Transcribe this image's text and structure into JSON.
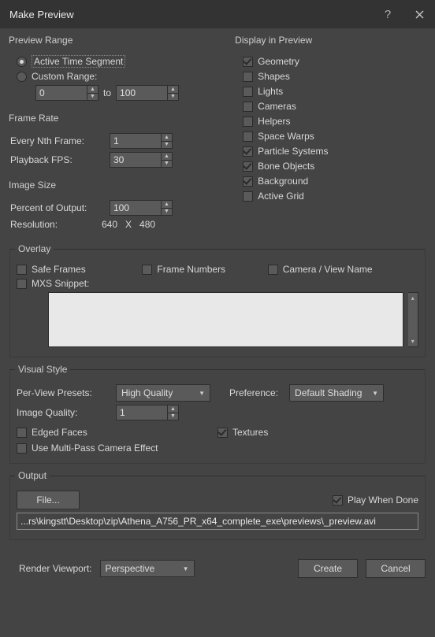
{
  "title": "Make Preview",
  "previewRange": {
    "legend": "Preview Range",
    "activeLabel": "Active Time Segment",
    "customLabel": "Custom Range:",
    "from": "0",
    "toLabel": "to",
    "to": "100"
  },
  "frameRate": {
    "legend": "Frame Rate",
    "everyNthLabel": "Every Nth Frame:",
    "everyNth": "1",
    "playbackLabel": "Playback FPS:",
    "playback": "30"
  },
  "imageSize": {
    "legend": "Image Size",
    "percentLabel": "Percent of Output:",
    "percent": "100",
    "resolutionLabel": "Resolution:",
    "resW": "640",
    "resX": "X",
    "resH": "480"
  },
  "display": {
    "legend": "Display in Preview",
    "items": [
      {
        "label": "Geometry",
        "checked": true
      },
      {
        "label": "Shapes",
        "checked": false
      },
      {
        "label": "Lights",
        "checked": false
      },
      {
        "label": "Cameras",
        "checked": false
      },
      {
        "label": "Helpers",
        "checked": false
      },
      {
        "label": "Space Warps",
        "checked": false
      },
      {
        "label": "Particle Systems",
        "checked": true
      },
      {
        "label": "Bone Objects",
        "checked": true
      },
      {
        "label": "Background",
        "checked": true
      },
      {
        "label": "Active Grid",
        "checked": false
      }
    ]
  },
  "overlay": {
    "legend": "Overlay",
    "safeFrames": "Safe Frames",
    "frameNumbers": "Frame Numbers",
    "cameraView": "Camera / View Name",
    "mxsLabel": "MXS Snippet:",
    "mxsText": ""
  },
  "visualStyle": {
    "legend": "Visual Style",
    "perViewLabel": "Per-View Presets:",
    "perView": "High Quality",
    "preferenceLabel": "Preference:",
    "preference": "Default Shading",
    "imageQualityLabel": "Image Quality:",
    "imageQuality": "1",
    "edgedFaces": "Edged Faces",
    "textures": "Textures",
    "multiPass": "Use Multi-Pass Camera Effect"
  },
  "output": {
    "legend": "Output",
    "fileBtn": "File...",
    "playWhenDone": "Play When Done",
    "path": "...rs\\kingstt\\Desktop\\zip\\Athena_A756_PR_x64_complete_exe\\previews\\_preview.avi"
  },
  "bottom": {
    "renderViewportLabel": "Render Viewport:",
    "renderViewport": "Perspective",
    "create": "Create",
    "cancel": "Cancel"
  }
}
